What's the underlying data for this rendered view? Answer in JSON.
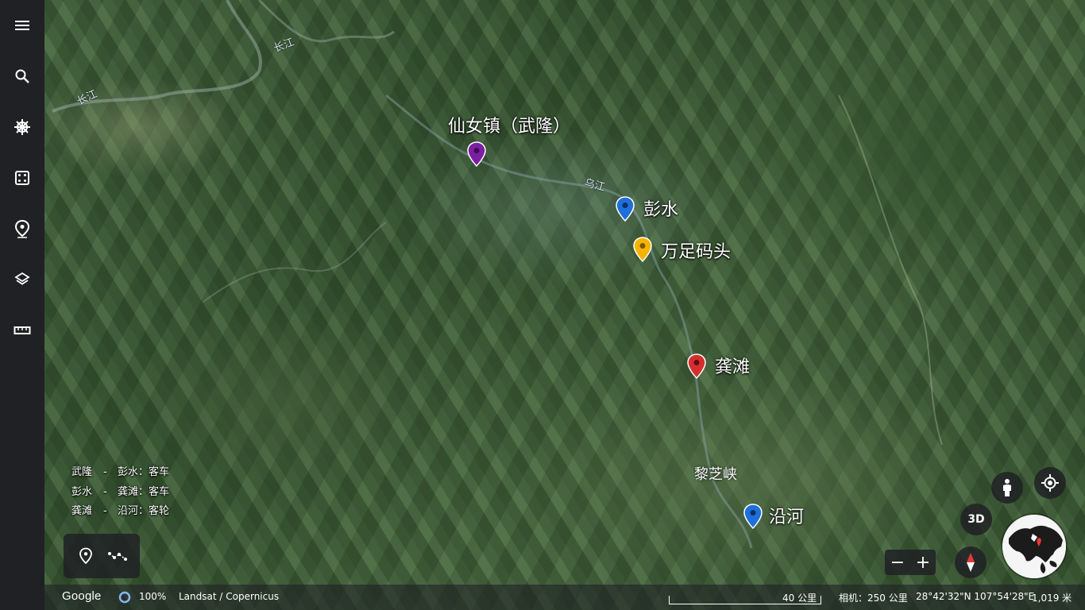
{
  "sidebar": {
    "items": [
      {
        "name": "menu",
        "icon": "menu-icon"
      },
      {
        "name": "search",
        "icon": "search-icon"
      },
      {
        "name": "voyager",
        "icon": "ship-wheel-icon"
      },
      {
        "name": "random",
        "icon": "dice-icon"
      },
      {
        "name": "projects",
        "icon": "map-pin-icon"
      },
      {
        "name": "map-style",
        "icon": "layers-icon"
      },
      {
        "name": "measure",
        "icon": "ruler-icon"
      }
    ]
  },
  "map": {
    "places": [
      {
        "id": "xiannvzhen",
        "label": "仙女镇（武隆）",
        "color": "#7b1fa2"
      },
      {
        "id": "pengshui",
        "label": "彭水",
        "color": "#1e6fd9"
      },
      {
        "id": "wanzu",
        "label": "万足码头",
        "color": "#f4b400"
      },
      {
        "id": "gongtan",
        "label": "龚滩",
        "color": "#d32f2f"
      },
      {
        "id": "yanhe",
        "label": "沿河",
        "color": "#1e6fd9"
      }
    ],
    "river_labels": {
      "changjiang_1": "长江",
      "changjiang_2": "长江",
      "wujiang": "乌江"
    },
    "place_text": {
      "lizhixia": "黎芝峡"
    }
  },
  "legend": [
    {
      "from": "武隆",
      "sep": "-",
      "to": "彭水",
      "mode": "：客车"
    },
    {
      "from": "彭水",
      "sep": "-",
      "to": "龚滩",
      "mode": "：客车"
    },
    {
      "from": "龚滩",
      "sep": "-",
      "to": "沿河",
      "mode": "：客轮"
    }
  ],
  "toolbox": {
    "items": [
      "placemark-icon",
      "path-icon"
    ]
  },
  "controls": {
    "three_d": "3D",
    "zoom_out": "−",
    "zoom_in": "+"
  },
  "status": {
    "logo": "Google",
    "progress": "100%",
    "attribution": "Landsat / Copernicus",
    "scale": "40 公里",
    "camera": "相机：250 公里",
    "coords": "28°42'32\"N 107°54'28\"E",
    "elevation": "1,019 米"
  }
}
